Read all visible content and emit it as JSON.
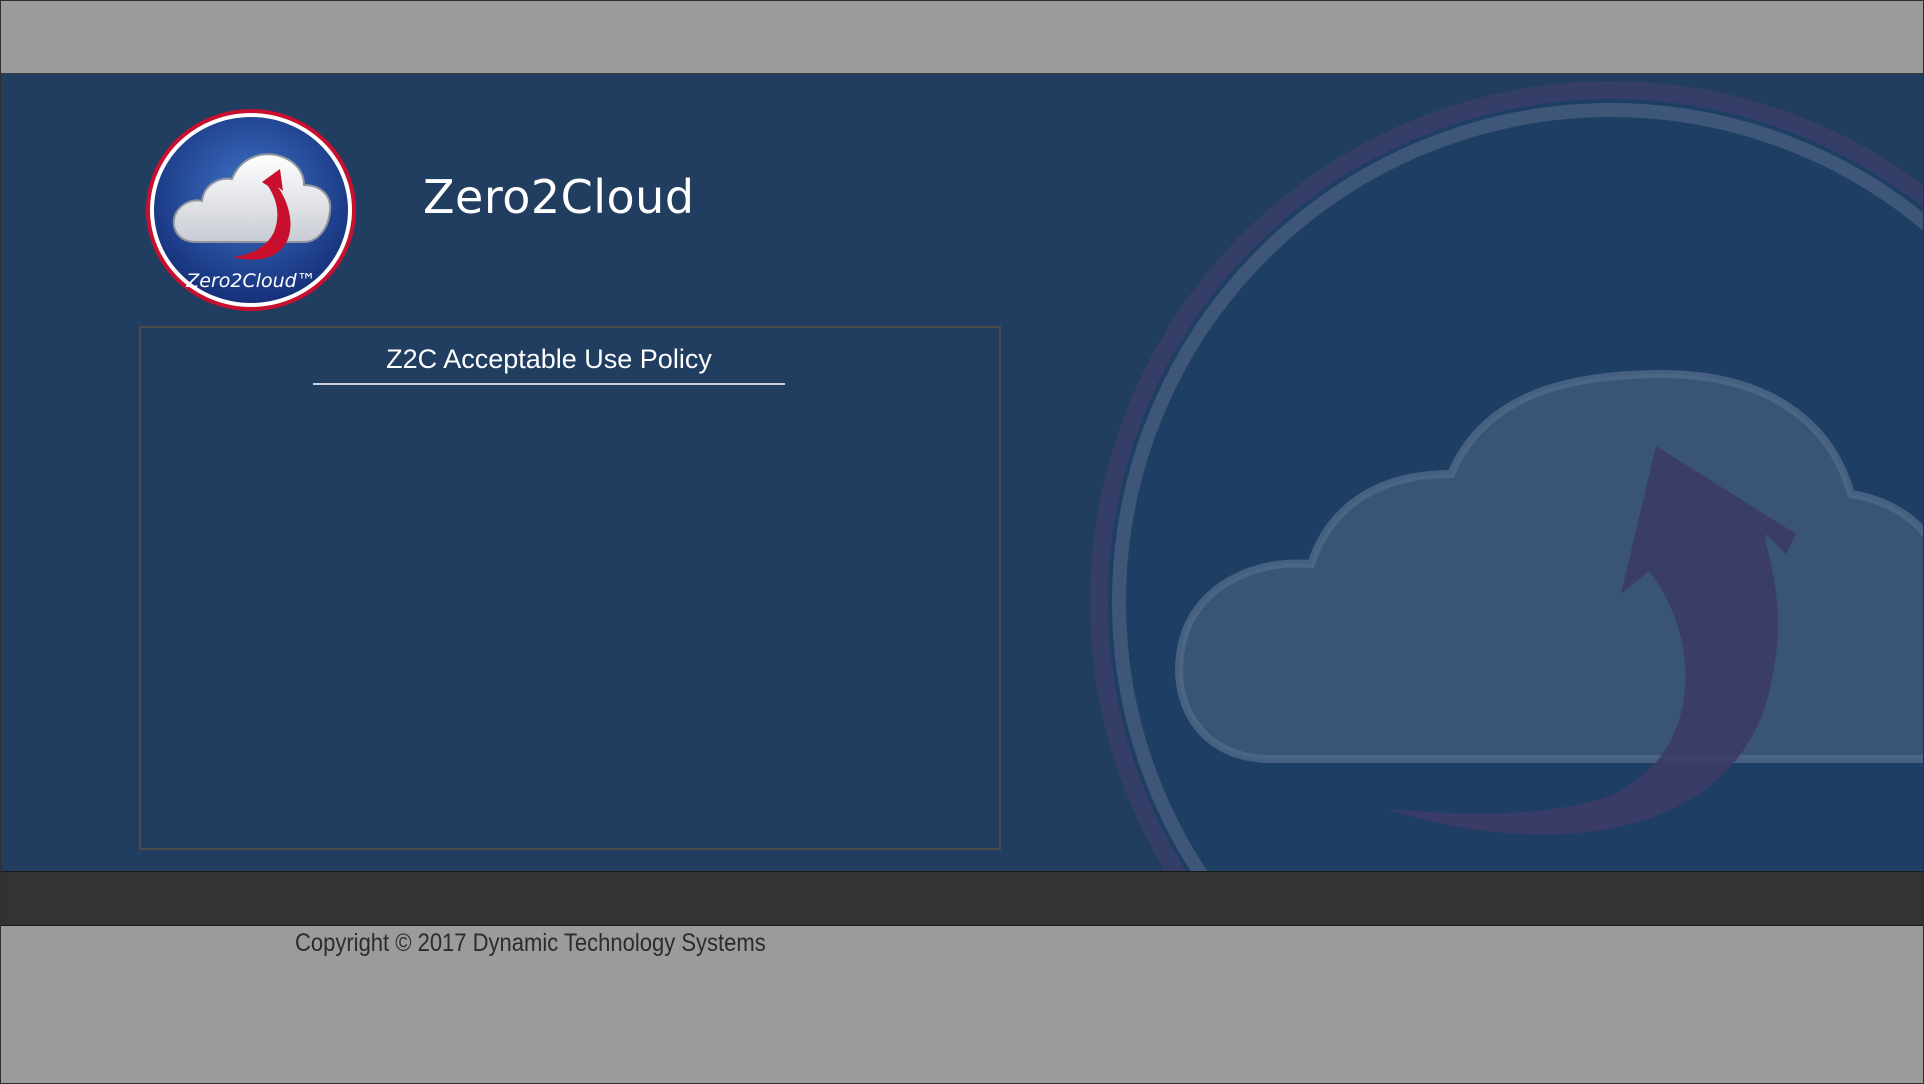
{
  "brand": {
    "name": "Zero2Cloud",
    "logo_text": "Zero2Cloud™"
  },
  "policy": {
    "title": "Z2C Acceptable Use Policy"
  },
  "footer": {
    "copyright": "Copyright © 2017 Dynamic Technology Systems"
  },
  "colors": {
    "hero_background": "#213d5f",
    "frame_gray": "#9b9b9b",
    "footer_bar": "#333333",
    "logo_ring_red": "#c8102e",
    "logo_blue": "#1d3f8f"
  }
}
